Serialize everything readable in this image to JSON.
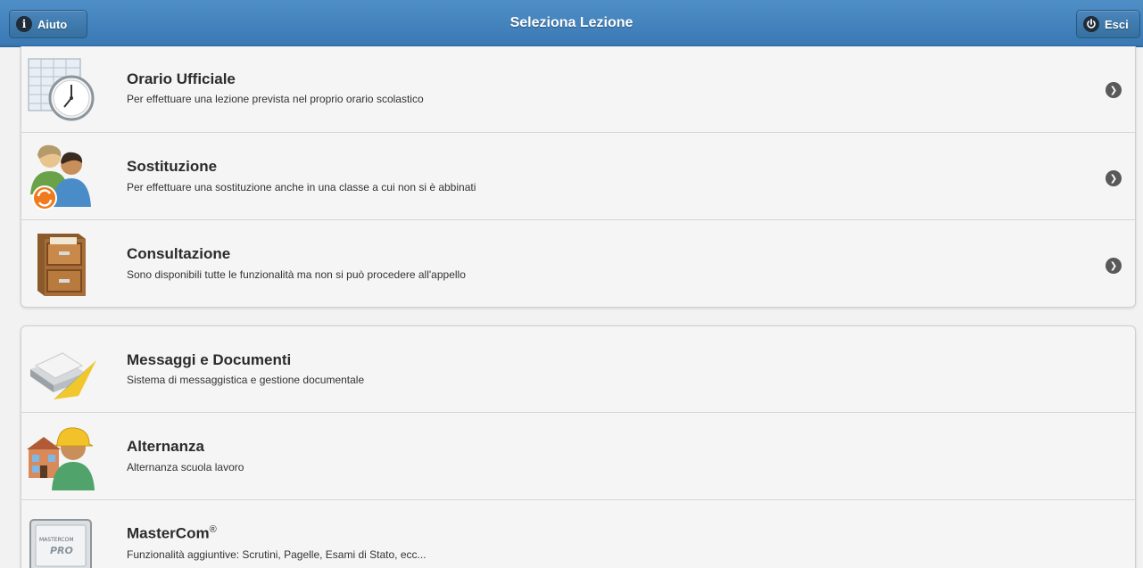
{
  "header": {
    "title": "Seleziona Lezione",
    "help_label": "Aiuto",
    "exit_label": "Esci"
  },
  "group1": {
    "items": [
      {
        "title": "Orario Ufficiale",
        "description": "Per effettuare una lezione prevista nel proprio orario scolastico",
        "icon": "timetable-clock-icon"
      },
      {
        "title": "Sostituzione",
        "description": "Per effettuare una sostituzione anche in una classe a cui non si è abbinati",
        "icon": "substitution-users-icon"
      },
      {
        "title": "Consultazione",
        "description": "Sono disponibili tutte le funzionalità ma non si può procedere all'appello",
        "icon": "filing-cabinet-icon"
      }
    ]
  },
  "group2": {
    "items": [
      {
        "title": "Messaggi e Documenti",
        "description": "Sistema di messaggistica e gestione documentale",
        "icon": "messages-documents-icon"
      },
      {
        "title": "Alternanza",
        "description": "Alternanza scuola lavoro",
        "icon": "worker-school-icon"
      },
      {
        "title": "MasterCom",
        "title_sup": "®",
        "description": "Funzionalità aggiuntive: Scrutini, Pagelle, Esami di Stato, ecc...",
        "icon": "mastercom-pro-icon",
        "logo_text": "MASTERCOM PRO"
      }
    ]
  },
  "colors": {
    "header": "#3f80bd",
    "background": "#f2f2f2",
    "chevron": "#595959"
  }
}
